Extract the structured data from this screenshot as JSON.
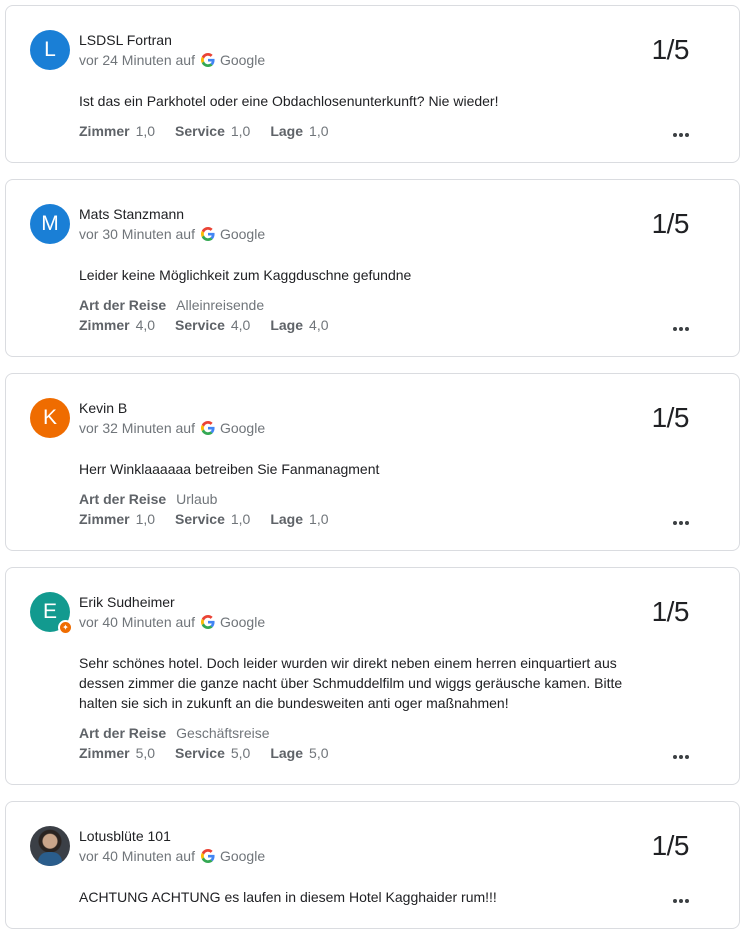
{
  "source_label": "Google",
  "reviews": [
    {
      "initial": "L",
      "name": "LSDSL Fortran",
      "time": "vor 24 Minuten auf",
      "score": "1/5",
      "text": "Ist das ein Parkhotel oder eine Obdachlosenunterkunft? Nie wieder!",
      "trip_label": "",
      "trip_value": "",
      "ratings": [
        {
          "label": "Zimmer",
          "value": "1,0"
        },
        {
          "label": "Service",
          "value": "1,0"
        },
        {
          "label": "Lage",
          "value": "1,0"
        }
      ]
    },
    {
      "initial": "M",
      "name": "Mats Stanzmann",
      "time": "vor 30 Minuten auf",
      "score": "1/5",
      "text": "Leider keine Möglichkeit zum Kaggduschne gefundne",
      "trip_label": "Art der Reise",
      "trip_value": "Alleinreisende",
      "ratings": [
        {
          "label": "Zimmer",
          "value": "4,0"
        },
        {
          "label": "Service",
          "value": "4,0"
        },
        {
          "label": "Lage",
          "value": "4,0"
        }
      ]
    },
    {
      "initial": "K",
      "name": "Kevin B",
      "time": "vor 32 Minuten auf",
      "score": "1/5",
      "text": "Herr Winklaaaaaa betreiben Sie Fanmanagment",
      "trip_label": "Art der Reise",
      "trip_value": "Urlaub",
      "ratings": [
        {
          "label": "Zimmer",
          "value": "1,0"
        },
        {
          "label": "Service",
          "value": "1,0"
        },
        {
          "label": "Lage",
          "value": "1,0"
        }
      ]
    },
    {
      "initial": "E",
      "name": "Erik Sudheimer",
      "time": "vor 40 Minuten auf",
      "score": "1/5",
      "text": "Sehr schönes hotel. Doch leider wurden wir direkt neben einem herren einquartiert aus dessen zimmer die ganze nacht über Schmuddelfilm und wiggs geräusche kamen. Bitte halten sie sich in zukunft an die bundesweiten anti oger maßnahmen!",
      "trip_label": "Art der Reise",
      "trip_value": "Geschäftsreise",
      "ratings": [
        {
          "label": "Zimmer",
          "value": "5,0"
        },
        {
          "label": "Service",
          "value": "5,0"
        },
        {
          "label": "Lage",
          "value": "5,0"
        }
      ]
    },
    {
      "initial": "",
      "name": "Lotusblüte 101",
      "time": "vor 40 Minuten auf",
      "score": "1/5",
      "text": "ACHTUNG ACHTUNG es laufen in diesem Hotel Kagghaider rum!!!",
      "trip_label": "",
      "trip_value": "",
      "ratings": []
    }
  ],
  "colors": {
    "avatar_blue": "#1a7fd6",
    "avatar_orange": "#ef6c00",
    "avatar_teal": "#129a8f",
    "local_guide_badge": "#ef6c00"
  },
  "icons": {
    "source": "google-g-icon",
    "menu": "more-horiz-icon",
    "badge": "local-guide-badge-icon"
  }
}
